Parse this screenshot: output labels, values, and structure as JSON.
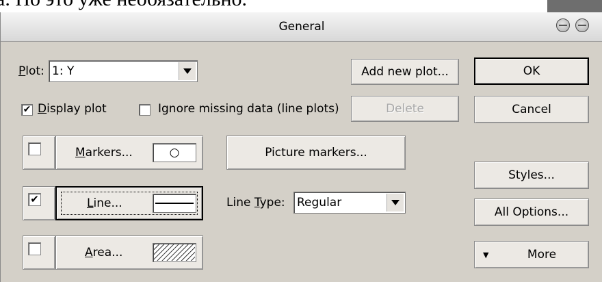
{
  "background": {
    "overflow_text": "а. Но это уже необязательно."
  },
  "dialog": {
    "title": "General"
  },
  "plot": {
    "label_accel": "P",
    "label_rest": "lot:",
    "selected": "1: Y"
  },
  "buttons": {
    "add_new_plot": "Add new plot...",
    "delete": "Delete",
    "ok": "OK",
    "cancel": "Cancel",
    "styles": "Styles...",
    "all_options": "All Options...",
    "more": "More",
    "more_icon_glyph": "▼"
  },
  "checkboxes": {
    "display_plot_accel": "D",
    "display_plot_rest": "isplay plot",
    "display_plot_checked": true,
    "ignore_missing": "Ignore missing data (line plots)",
    "ignore_missing_checked": false
  },
  "markers": {
    "accel": "M",
    "rest": "arkers...",
    "enabled": false,
    "symbol": "○",
    "picture_markers": "Picture markers..."
  },
  "line": {
    "accel": "L",
    "rest": "ine...",
    "enabled": true,
    "type_label_pre": "Line ",
    "type_label_accel": "T",
    "type_label_post": "ype:",
    "type_selected": "Regular"
  },
  "area": {
    "accel": "A",
    "rest": "rea...",
    "enabled": false
  },
  "icons": {
    "dropdown": "triangle-down",
    "check": "✔"
  }
}
